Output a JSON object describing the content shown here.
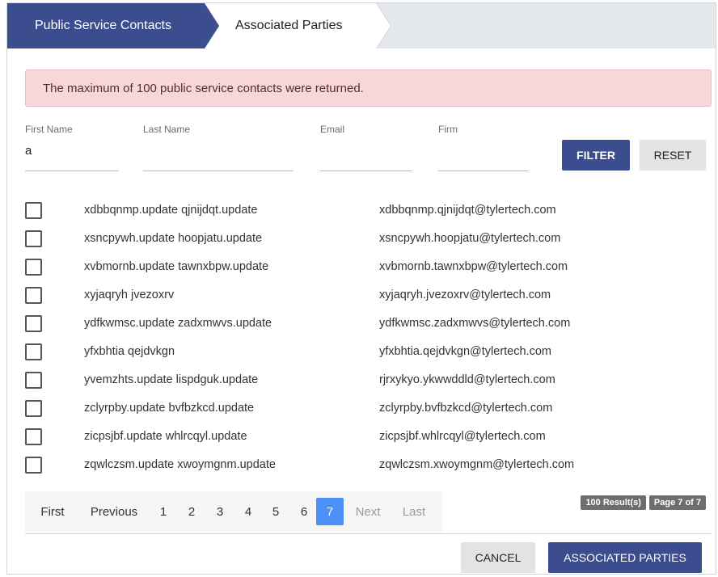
{
  "steps": [
    {
      "label": "Public Service Contacts"
    },
    {
      "label": "Associated Parties"
    }
  ],
  "alert": {
    "message": "The maximum of 100 public service contacts were returned."
  },
  "filters": {
    "first_name": {
      "label": "First Name",
      "value": "a"
    },
    "last_name": {
      "label": "Last Name",
      "value": ""
    },
    "email": {
      "label": "Email",
      "value": ""
    },
    "firm": {
      "label": "Firm",
      "value": ""
    }
  },
  "buttons": {
    "filter": "FILTER",
    "reset": "RESET",
    "cancel": "CANCEL",
    "associated_parties": "ASSOCIATED PARTIES"
  },
  "contacts": [
    {
      "name": "xdbbqnmp.update qjnijdqt.update",
      "email": "xdbbqnmp.qjnijdqt@tylertech.com",
      "checked": false
    },
    {
      "name": "xsncpywh.update hoopjatu.update",
      "email": "xsncpywh.hoopjatu@tylertech.com",
      "checked": false
    },
    {
      "name": "xvbmornb.update tawnxbpw.update",
      "email": "xvbmornb.tawnxbpw@tylertech.com",
      "checked": false
    },
    {
      "name": "xyjaqryh jvezoxrv",
      "email": "xyjaqryh.jvezoxrv@tylertech.com",
      "checked": false
    },
    {
      "name": "ydfkwmsc.update zadxmwvs.update",
      "email": "ydfkwmsc.zadxmwvs@tylertech.com",
      "checked": false
    },
    {
      "name": "yfxbhtia qejdvkgn",
      "email": "yfxbhtia.qejdvkgn@tylertech.com",
      "checked": false
    },
    {
      "name": "yvemzhts.update lispdguk.update",
      "email": "rjrxykyo.ykwwddld@tylertech.com",
      "checked": false
    },
    {
      "name": "zclyrpby.update bvfbzkcd.update",
      "email": "zclyrpby.bvfbzkcd@tylertech.com",
      "checked": false
    },
    {
      "name": "zicpsjbf.update whlrcqyl.update",
      "email": "zicpsjbf.whlrcqyl@tylertech.com",
      "checked": false
    },
    {
      "name": "zqwlczsm.update xwoymgnm.update",
      "email": "zqwlczsm.xwoymgnm@tylertech.com",
      "checked": false
    }
  ],
  "pagination": {
    "first": "First",
    "previous": "Previous",
    "pages": [
      "1",
      "2",
      "3",
      "4",
      "5",
      "6",
      "7"
    ],
    "current": "7",
    "next": "Next",
    "last": "Last"
  },
  "summary": {
    "results": "100 Result(s)",
    "page": "Page 7 of 7"
  },
  "colors": {
    "primary": "#3b4d8f",
    "active_page": "#4a90f5",
    "alert_bg": "#f8d7da"
  }
}
